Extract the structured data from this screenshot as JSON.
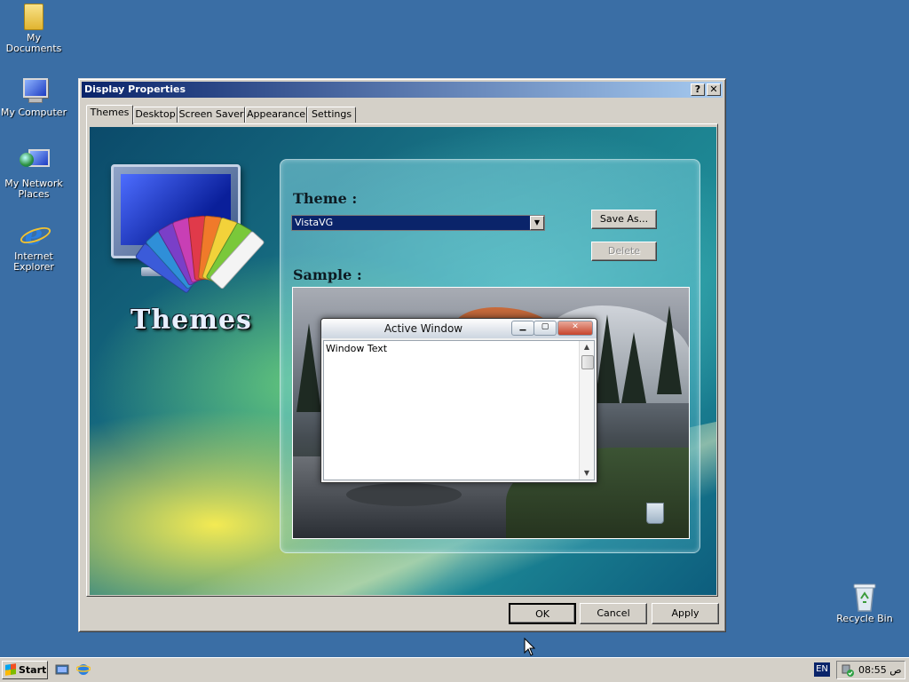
{
  "desktop": {
    "icons": [
      {
        "label": "My Documents",
        "icon": "folder-icon"
      },
      {
        "label": "My Computer",
        "icon": "computer-icon"
      },
      {
        "label": "My Network\nPlaces",
        "icon": "network-icon"
      },
      {
        "label": "Internet\nExplorer",
        "icon": "ie-icon"
      },
      {
        "label": "Recycle Bin",
        "icon": "recycle-bin-icon"
      }
    ]
  },
  "dialog": {
    "title": "Display Properties",
    "help_glyph": "?",
    "close_glyph": "✕",
    "tabs": [
      "Themes",
      "Desktop",
      "Screen Saver",
      "Appearance",
      "Settings"
    ],
    "active_tab": "Themes",
    "logo_text": "Themes",
    "theme_label": "Theme :",
    "theme_value": "VistaVG",
    "save_as_label": "Save As...",
    "delete_label": "Delete",
    "sample_label": "Sample :",
    "sample_window": {
      "title": "Active Window",
      "text": "Window Text"
    },
    "ok_label": "OK",
    "cancel_label": "Cancel",
    "apply_label": "Apply"
  },
  "taskbar": {
    "start_label": "Start",
    "language": "EN",
    "clock": "08:55 ص"
  },
  "colors": {
    "desktop": "#3a6ea5",
    "titlebar_start": "#0a246a",
    "titlebar_end": "#a6caf0",
    "selection": "#0a246a"
  }
}
